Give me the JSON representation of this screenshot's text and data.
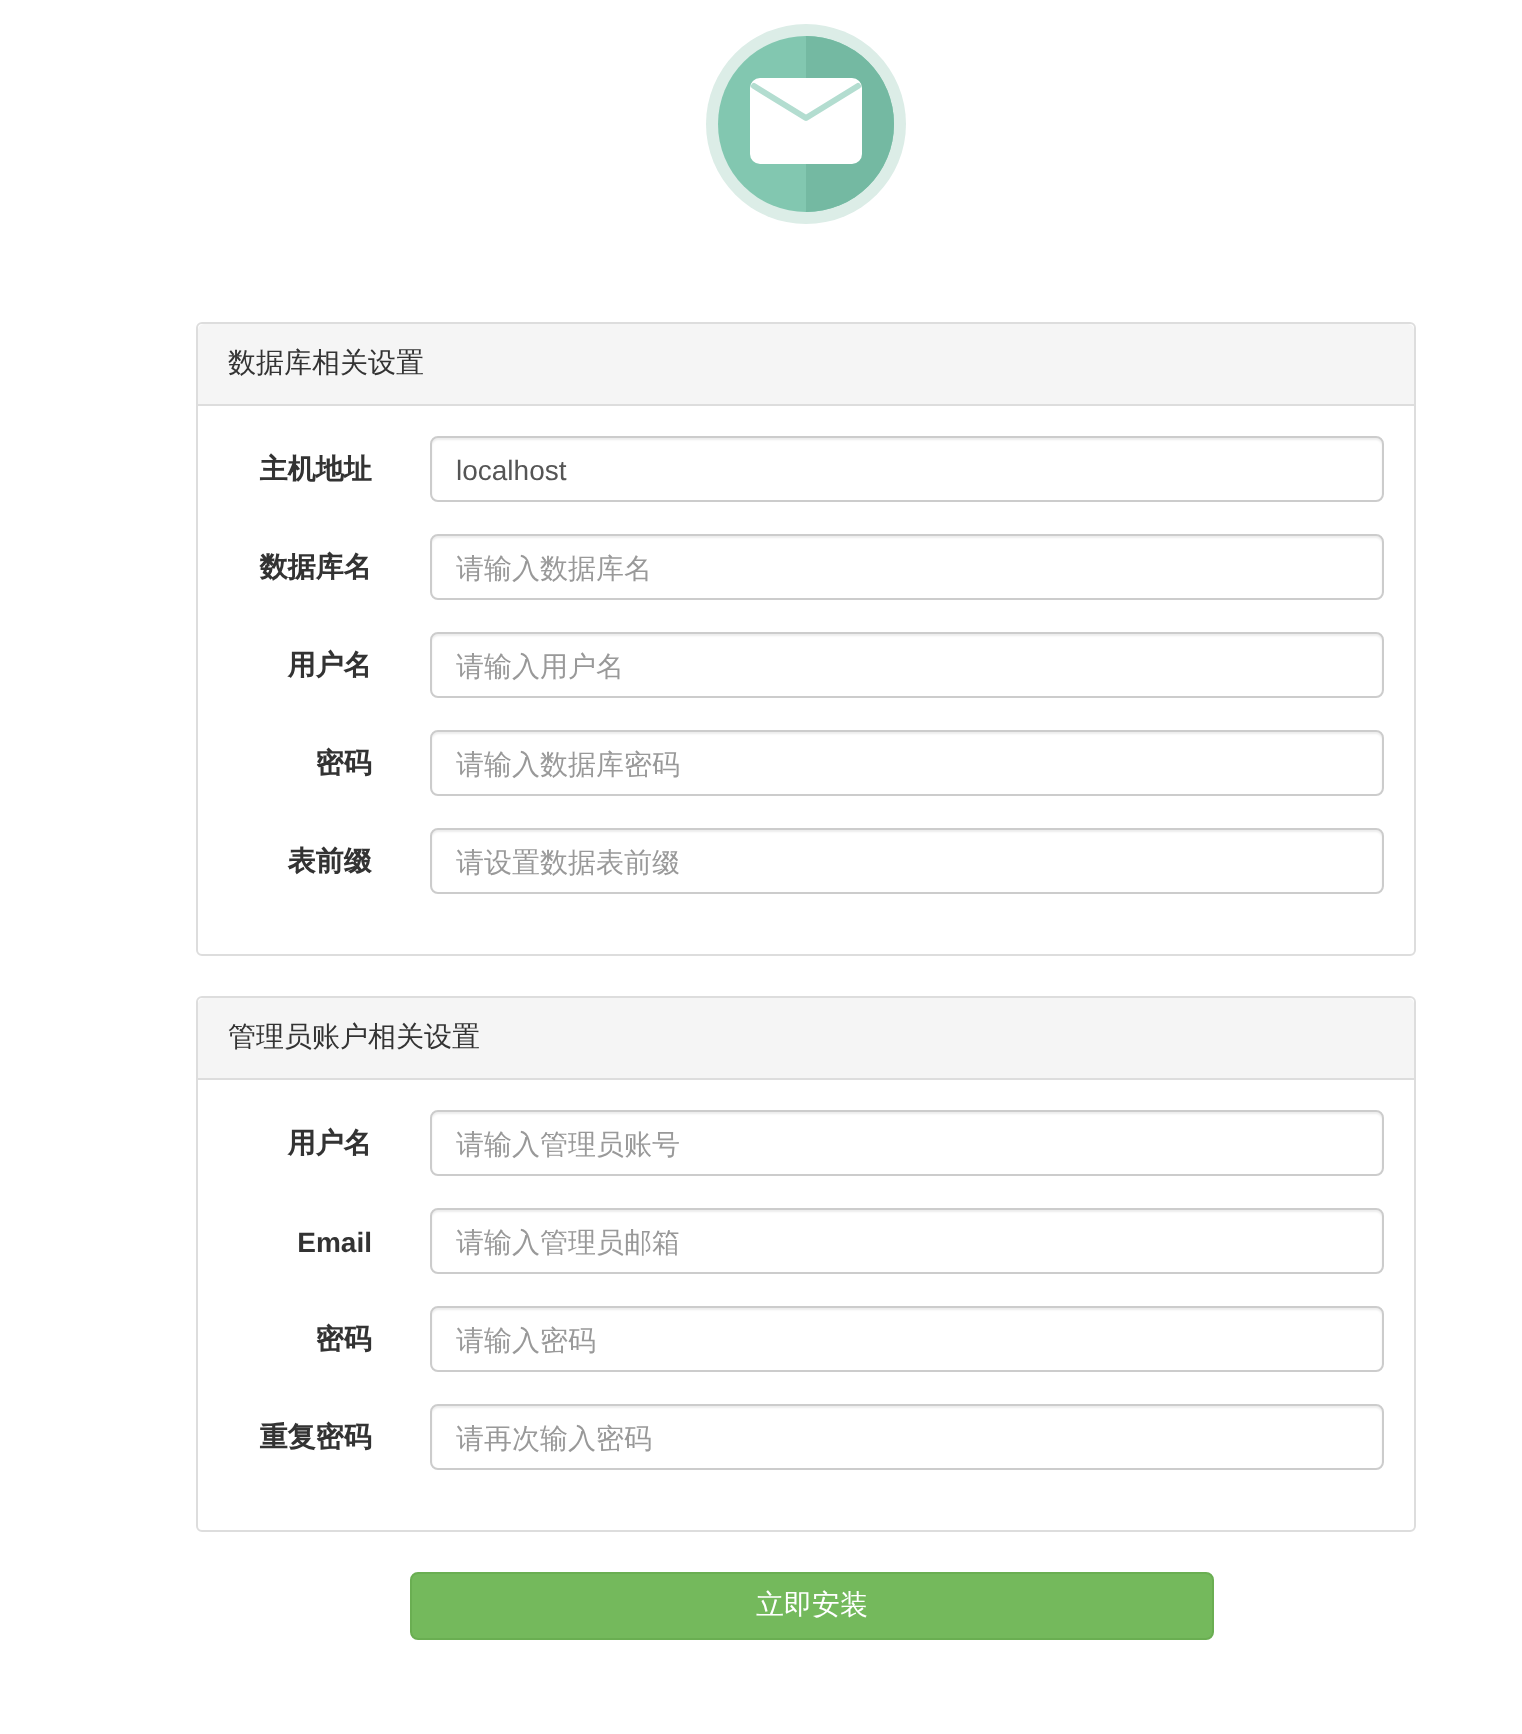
{
  "sections": [
    {
      "title": "数据库相关设置",
      "fields": [
        {
          "label": "主机地址",
          "value": "localhost"
        },
        {
          "label": "数据库名",
          "placeholder": "请输入数据库名"
        },
        {
          "label": "用户名",
          "placeholder": "请输入用户名"
        },
        {
          "label": "密码",
          "placeholder": "请输入数据库密码"
        },
        {
          "label": "表前缀",
          "placeholder": "请设置数据表前缀"
        }
      ]
    },
    {
      "title": "管理员账户相关设置",
      "fields": [
        {
          "label": "用户名",
          "placeholder": "请输入管理员账号"
        },
        {
          "label": "Email",
          "placeholder": "请输入管理员邮箱"
        },
        {
          "label": "密码",
          "placeholder": "请输入密码"
        },
        {
          "label": "重复密码",
          "placeholder": "请再次输入密码"
        }
      ]
    }
  ],
  "submit_button": {
    "label": "立即安装"
  }
}
